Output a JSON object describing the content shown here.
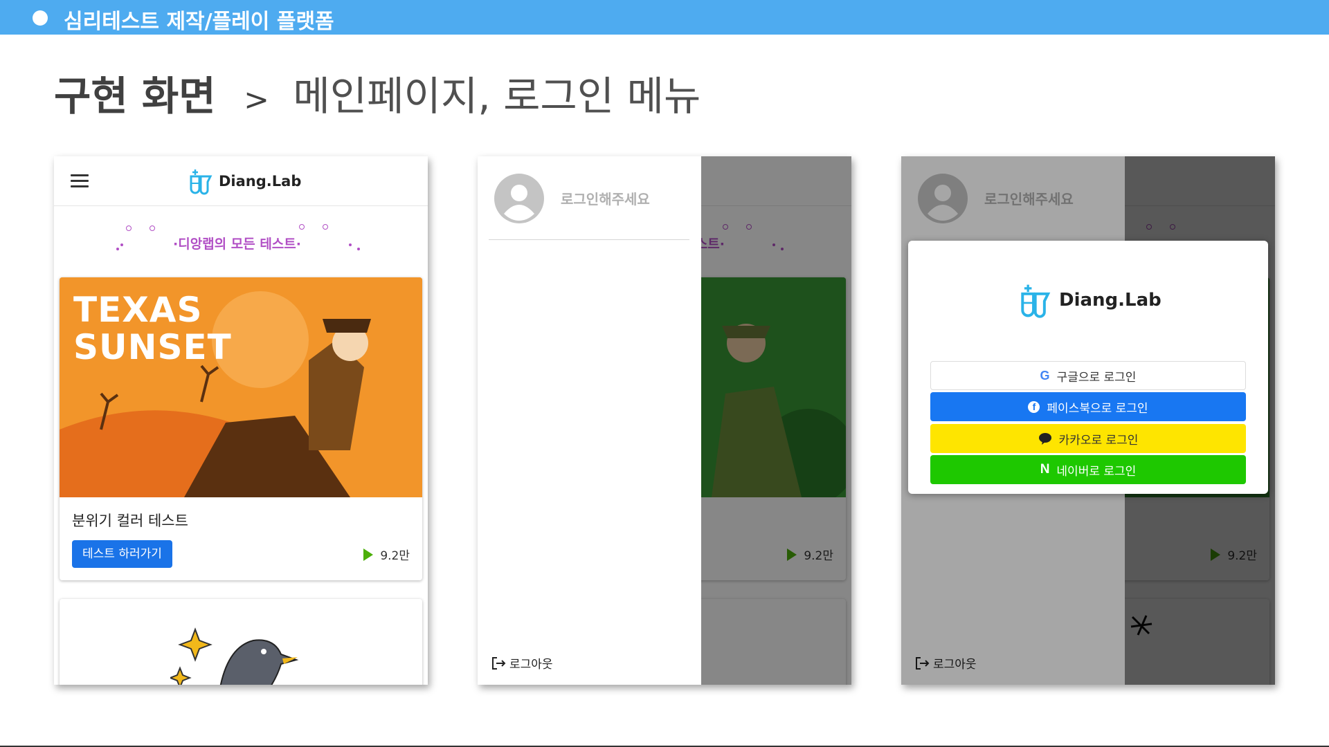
{
  "slide": {
    "header_title": "심리테스트 제작/플레이 플랫폼",
    "heading_bold": "구현 화면",
    "heading_sep": ">",
    "heading_light": "메인페이지, 로그인 메뉴"
  },
  "app": {
    "brand": "Diang.Lab",
    "subtitle": "·디앙랩의 모든 테스트·",
    "card1": {
      "image_text": [
        "TEXAS",
        "SUNSET"
      ],
      "title": "분위기 컬러 테스트",
      "button_label": "테스트 하러가기",
      "plays": "9.2만"
    }
  },
  "drawer": {
    "prompt": "로그인해주세요",
    "logout_label": "로그아웃"
  },
  "login_modal": {
    "brand": "Diang.Lab",
    "google_label": "구글으로 로그인",
    "facebook_label": "페이스북으로 로그인",
    "kakao_label": "카카오로 로그인",
    "naver_label": "네이버로 로그인"
  },
  "colors": {
    "header_bar": "#4eabf0",
    "primary_button": "#1a73e8",
    "facebook": "#1877f2",
    "kakao": "#fee500",
    "naver": "#1ec800",
    "subtitle": "#b14fc5"
  },
  "icons": [
    "menu-icon",
    "flask-logo-icon",
    "play-icon",
    "avatar-icon",
    "logout-icon",
    "google-icon",
    "facebook-icon",
    "kakao-icon",
    "naver-icon"
  ]
}
